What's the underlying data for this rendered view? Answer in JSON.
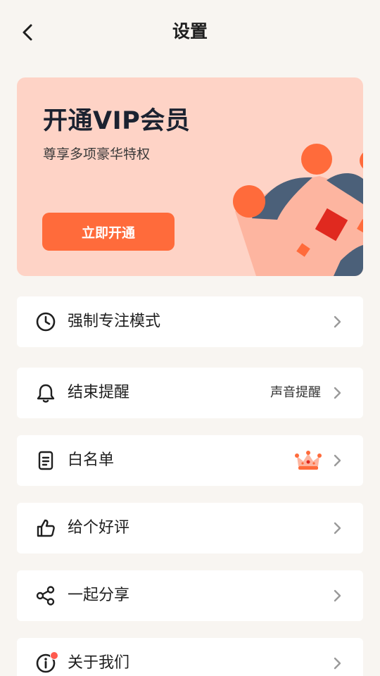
{
  "header": {
    "title": "设置",
    "back_icon": "chevron-left-icon"
  },
  "vip_banner": {
    "title": "开通VIP会员",
    "subtitle": "尊享多项豪华特权",
    "button_label": "立即开通",
    "background_color": "#fed3c6",
    "button_color": "#ff6b3b"
  },
  "settings": {
    "items": [
      {
        "label": "强制专注模式",
        "icon": "clock-icon",
        "value": ""
      },
      {
        "label": "结束提醒",
        "icon": "bell-icon",
        "value": "声音提醒"
      },
      {
        "label": "白名单",
        "icon": "clipboard-icon",
        "value": "",
        "badge": "crown-icon"
      },
      {
        "label": "给个好评",
        "icon": "thumbs-up-icon",
        "value": ""
      },
      {
        "label": "一起分享",
        "icon": "share-icon",
        "value": ""
      },
      {
        "label": "关于我们",
        "icon": "info-icon",
        "value": "",
        "badge": "notification-dot"
      }
    ]
  },
  "colors": {
    "page_background": "#f8f5f1",
    "accent": "#ff6b3b",
    "text_primary": "#1f1f1f"
  }
}
